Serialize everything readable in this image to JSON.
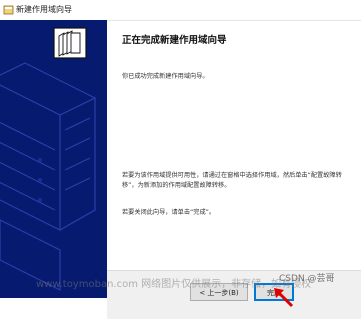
{
  "window": {
    "title": "新建作用域向导",
    "title_icon": "wizard-icon"
  },
  "banner": {
    "icon": "folder-document-icon",
    "color": "#061a70"
  },
  "content": {
    "heading": "正在完成新建作用域向导",
    "intro": "你已成功完成新建作用域向导。",
    "info": "若要为该作用域提供可用性，请通过在窗格中选择作用域，然后单击“配置故障转移”，为新添加的作用域配置故障转移。",
    "close_instruction": "若要关闭此向导，请单击“完成”。"
  },
  "footer": {
    "back_label": "< 上一步(B)",
    "finish_label": "完成"
  },
  "watermark": {
    "text": "www.toymoban.com 网络图片仅供展示，非存储，如有侵权",
    "csdn": "CSDN @芸哥"
  }
}
